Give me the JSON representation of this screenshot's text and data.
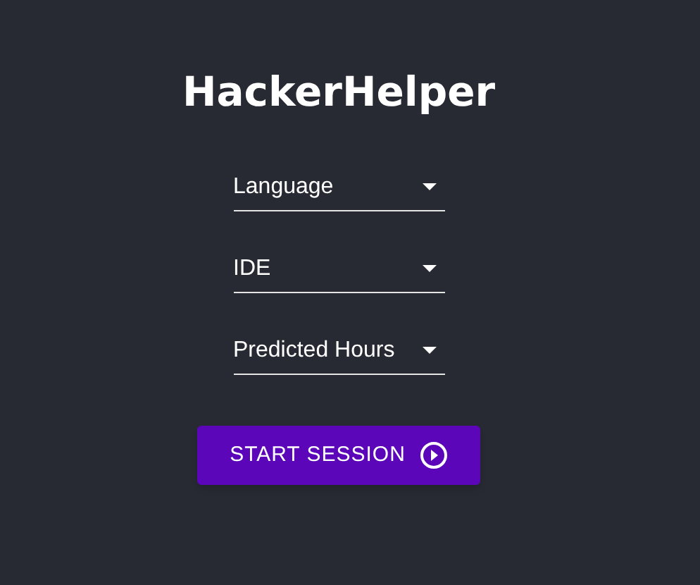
{
  "title": "HackerHelper",
  "selects": [
    {
      "label": "Language"
    },
    {
      "label": "IDE"
    },
    {
      "label": "Predicted Hours"
    }
  ],
  "button": {
    "label": "START SESSION"
  }
}
